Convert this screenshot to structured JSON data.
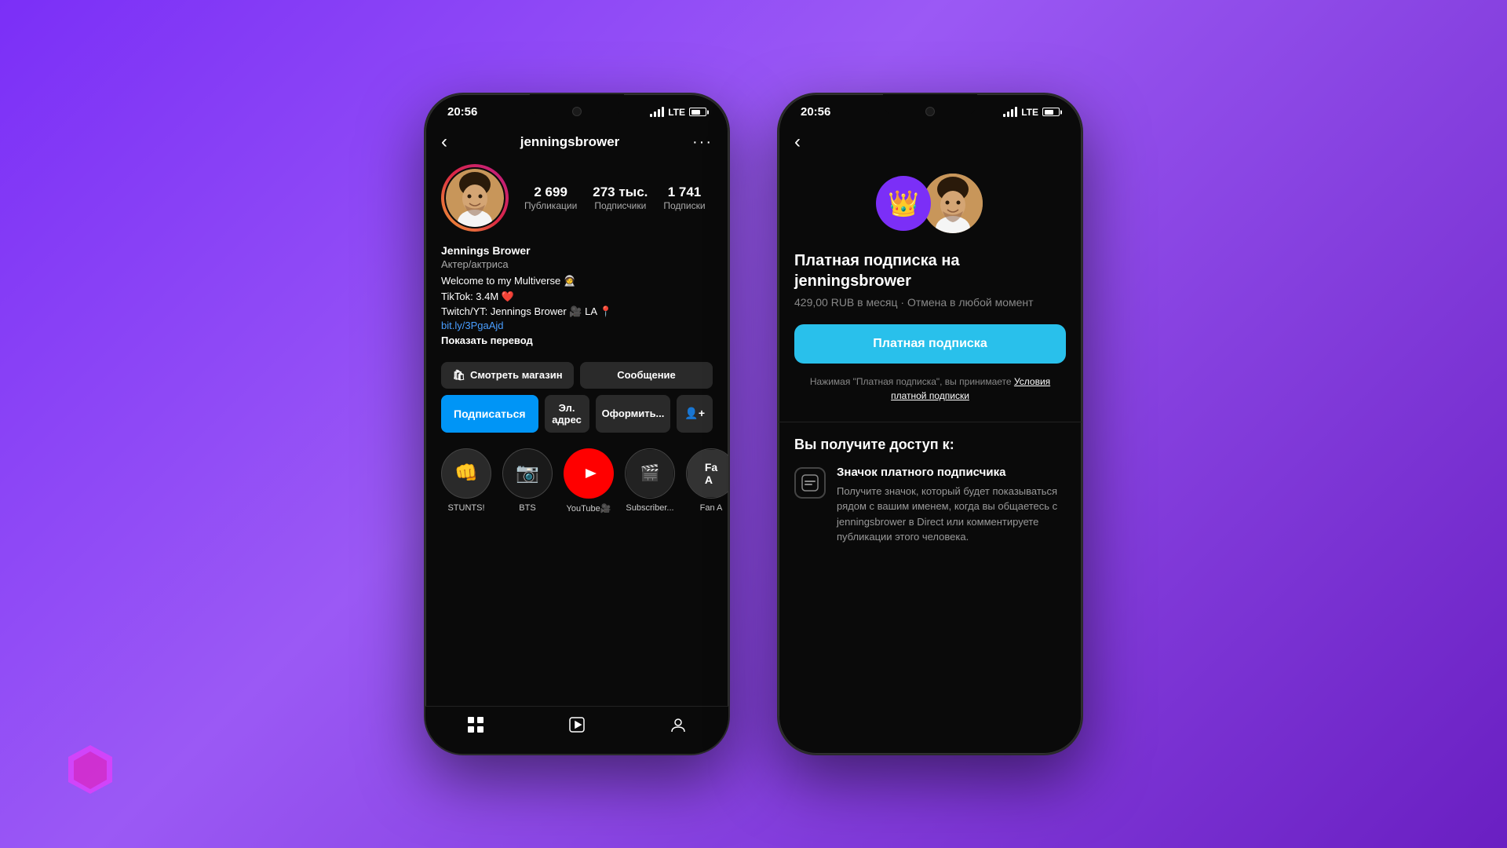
{
  "background": {
    "gradient_start": "#7b2ff7",
    "gradient_end": "#6a1fc2"
  },
  "phone1": {
    "status_bar": {
      "time": "20:56",
      "signal": "LTE"
    },
    "header": {
      "username": "jenningsbrower",
      "back_label": "‹",
      "more_label": "···"
    },
    "stats": [
      {
        "number": "2 699",
        "label": "Публикации"
      },
      {
        "number": "273 тыс.",
        "label": "Подписчики"
      },
      {
        "number": "1 741",
        "label": "Подписки"
      }
    ],
    "bio": {
      "name": "Jennings Brower",
      "role": "Актер/актриса",
      "line1": "Welcome to my Multiverse 🧑‍🚀",
      "line2": "TikTok: 3.4M ❤️",
      "line3": "Twitch/YT: Jennings Brower 🎥 LA 📍",
      "link": "bit.ly/3PgaAjd",
      "translate": "Показать перевод"
    },
    "buttons": {
      "shop": "Смотреть магазин",
      "message": "Сообщение",
      "subscribe": "Подписаться",
      "email": "Эл. адрес",
      "order": "Оформить...",
      "add_friend": "➕"
    },
    "highlights": [
      {
        "label": "STUNTS!",
        "icon": "🥊"
      },
      {
        "label": "BTS",
        "icon": "📷"
      },
      {
        "label": "YouTube🎥",
        "icon": "▶"
      },
      {
        "label": "Subscriber...",
        "icon": "🎬"
      },
      {
        "label": "Fan A",
        "icon": "Fa"
      }
    ],
    "nav": [
      "⊞",
      "▷",
      "👤"
    ]
  },
  "phone2": {
    "status_bar": {
      "time": "20:56",
      "signal": "LTE"
    },
    "header": {
      "back_label": "‹"
    },
    "subscription": {
      "title": "Платная подписка на jenningsbrower",
      "price": "429,00 RUB в месяц · Отмена в любой момент",
      "button_label": "Платная подписка",
      "terms_text": "Нажимая \"Платная подписка\", вы принимаете",
      "terms_link": "Условия платной подписки"
    },
    "access_section": {
      "title": "Вы получите доступ к:",
      "feature": {
        "title": "Значок платного подписчика",
        "desc": "Получите значок, который будет показываться рядом с вашим именем, когда вы общаетесь с jenningsbrower в Direct или комментируете публикации этого человека."
      }
    }
  }
}
